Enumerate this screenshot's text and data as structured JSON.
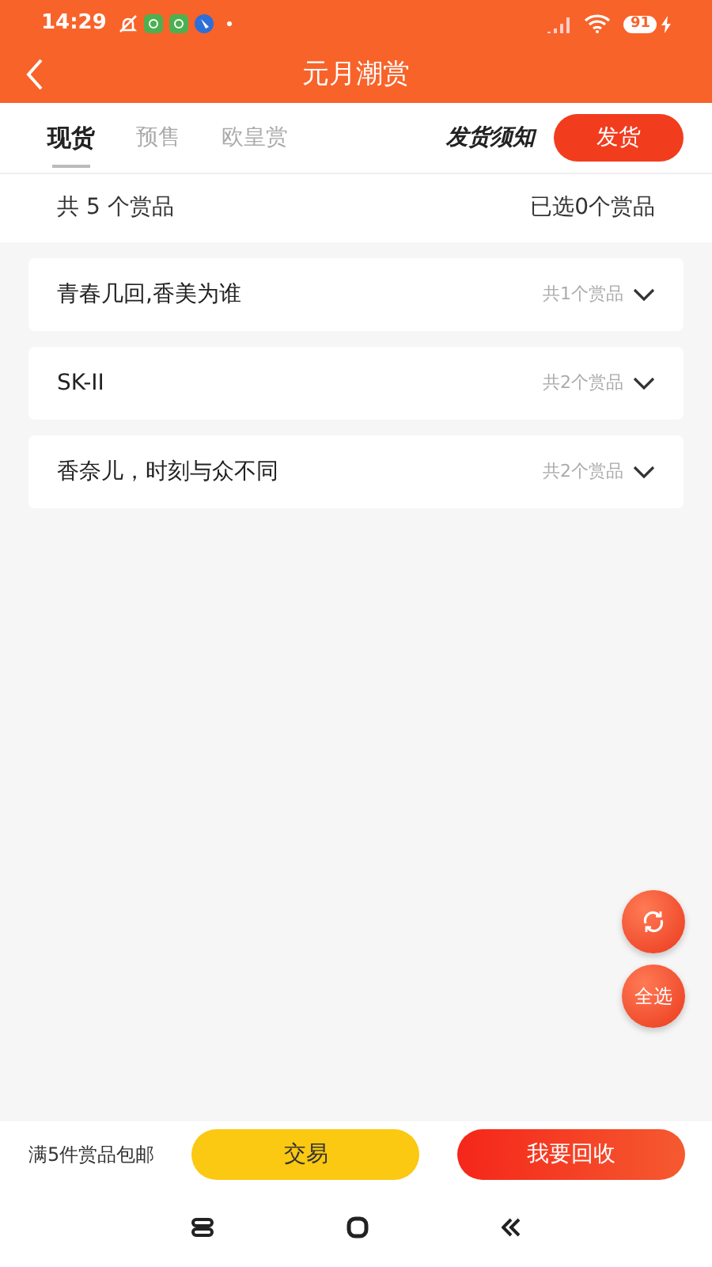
{
  "status_bar": {
    "time": "14:29",
    "battery": "91"
  },
  "header": {
    "title": "元月潮赏"
  },
  "tabs": [
    {
      "label": "现货",
      "selected": true
    },
    {
      "label": "预售",
      "selected": false
    },
    {
      "label": "欧皇赏",
      "selected": false
    }
  ],
  "notice_link": "发货须知",
  "ship_button": "发货",
  "summary": {
    "total": "共 5 个赏品",
    "selected_count": "已选0个赏品"
  },
  "groups": [
    {
      "name": "青春几回,香美为谁",
      "count": "共1个赏品",
      "expanded": false
    },
    {
      "name": "SK-II",
      "count": "共2个赏品",
      "expanded": false
    },
    {
      "name": "香奈儿，时刻与众不同",
      "count": "共2个赏品",
      "expanded": false
    }
  ],
  "floating_buttons": [
    {
      "kind": "refresh"
    },
    {
      "kind": "text",
      "label": "全选"
    }
  ],
  "footer": {
    "note": "满5件赏品包邮",
    "trade_button": "交易",
    "recycle_button": "我要回收"
  }
}
